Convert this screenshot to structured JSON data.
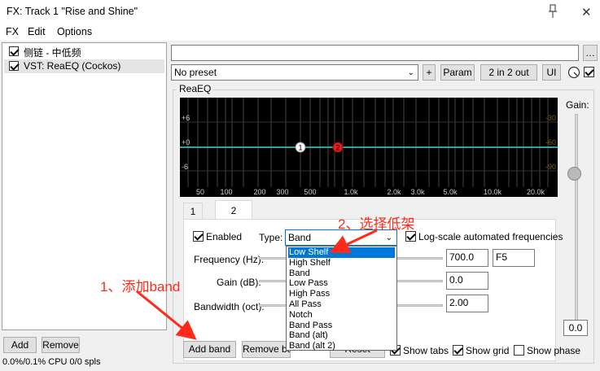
{
  "window": {
    "title": "FX: Track 1 \"Rise and Shine\""
  },
  "menu": [
    "FX",
    "Edit",
    "Options"
  ],
  "fx_list": [
    {
      "label": "侧链 - 中低频",
      "enabled": true
    },
    {
      "label": "VST: ReaEQ (Cockos)",
      "enabled": true
    }
  ],
  "left_buttons": {
    "add": "Add",
    "remove": "Remove"
  },
  "status": "0.0%/0.1% CPU 0/0 spls",
  "plugin_header": {
    "preset": "No preset",
    "plus": "+",
    "param": "Param",
    "io": "2 in 2 out",
    "ui": "UI"
  },
  "reaeq": {
    "group_label": "ReaEQ",
    "gain_label": "Gain:",
    "gain_value": "0.0",
    "graph": {
      "db_left": [
        "+6",
        "+0",
        "-6"
      ],
      "db_right": [
        "-30",
        "-60",
        "-90"
      ],
      "freq_labels": [
        "50",
        "100",
        "200",
        "300",
        "500",
        "1.0k",
        "2.0k",
        "3.0k",
        "5.0k",
        "10.0k",
        "20.0k"
      ],
      "nodes": [
        "1",
        "2"
      ]
    },
    "tabs": [
      "1",
      "2"
    ],
    "enabled_label": "Enabled",
    "type_label": "Type:",
    "type_value": "Band",
    "log_scale_label": "Log-scale automated frequencies",
    "frequency_label": "Frequency (Hz):",
    "frequency_value": "700.0",
    "note_value": "F5",
    "gain_db_label": "Gain (dB):",
    "gain_db_value": "0.0",
    "bandwidth_label": "Bandwidth (oct):",
    "bandwidth_value": "2.00",
    "type_options": [
      "Low Shelf",
      "High Shelf",
      "Band",
      "Low Pass",
      "High Pass",
      "All Pass",
      "Notch",
      "Band Pass",
      "Band (alt)",
      "Band (alt 2)"
    ],
    "highlighted_option": "Low Shelf",
    "bottom": {
      "add_band": "Add band",
      "remove_band": "Remove ba",
      "reset": "Reset",
      "show_tabs": "Show tabs",
      "show_grid": "Show grid",
      "show_phase": "Show phase"
    }
  },
  "annotations": {
    "step1": "1、添加band",
    "step2": "2、选择低架"
  },
  "colors": {
    "annotation": "#ff2a1a",
    "eq_curve": "#3fd8d8",
    "highlight": "#0078d7"
  }
}
